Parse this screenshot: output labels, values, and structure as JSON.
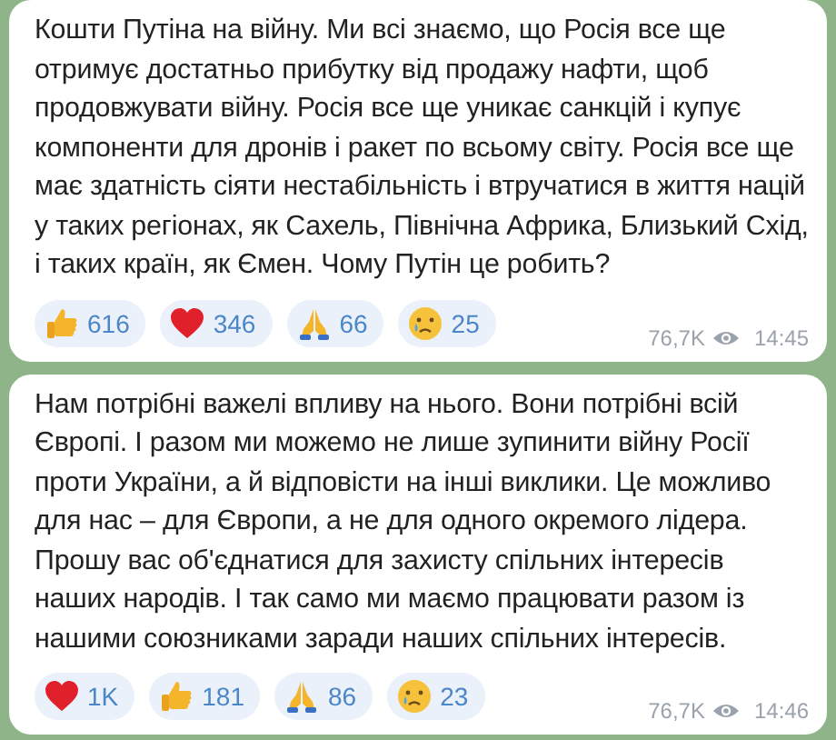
{
  "messages": [
    {
      "text": "Кошти Путіна на війну. Ми всі знаємо, що Росія все ще отримує достатньо прибутку від продажу нафти, щоб продовжувати війну. Росія все ще уникає санкцій і купує компоненти для дронів і ракет по всьому світу. Росія все ще має здатність сіяти нестабільність і втручатися в життя націй у таких регіонах, як Сахель, Північна Африка, Близький Схід, і таких країн, як Ємен. Чому Путін це робить?",
      "reactions": [
        {
          "kind": "thumbs",
          "count": "616"
        },
        {
          "kind": "heart",
          "count": "346"
        },
        {
          "kind": "pray",
          "count": "66"
        },
        {
          "kind": "cry",
          "count": "25"
        }
      ],
      "views": "76,7K",
      "time": "14:45"
    },
    {
      "text": "Нам потрібні важелі впливу на нього. Вони потрібні всій Європі. І разом ми можемо не лише зупинити війну Росії проти України, а й відповісти на інші виклики. Це можливо для нас – для Європи, а не для одного окремого лідера. Прошу вас об'єднатися для захисту спільних інтересів наших народів. І так само ми маємо працювати разом із нашими союзниками заради наших спільних інтересів.",
      "reactions": [
        {
          "kind": "heart",
          "count": "1K"
        },
        {
          "kind": "thumbs",
          "count": "181"
        },
        {
          "kind": "pray",
          "count": "86"
        },
        {
          "kind": "cry",
          "count": "23"
        }
      ],
      "views": "76,7K",
      "time": "14:46"
    }
  ]
}
